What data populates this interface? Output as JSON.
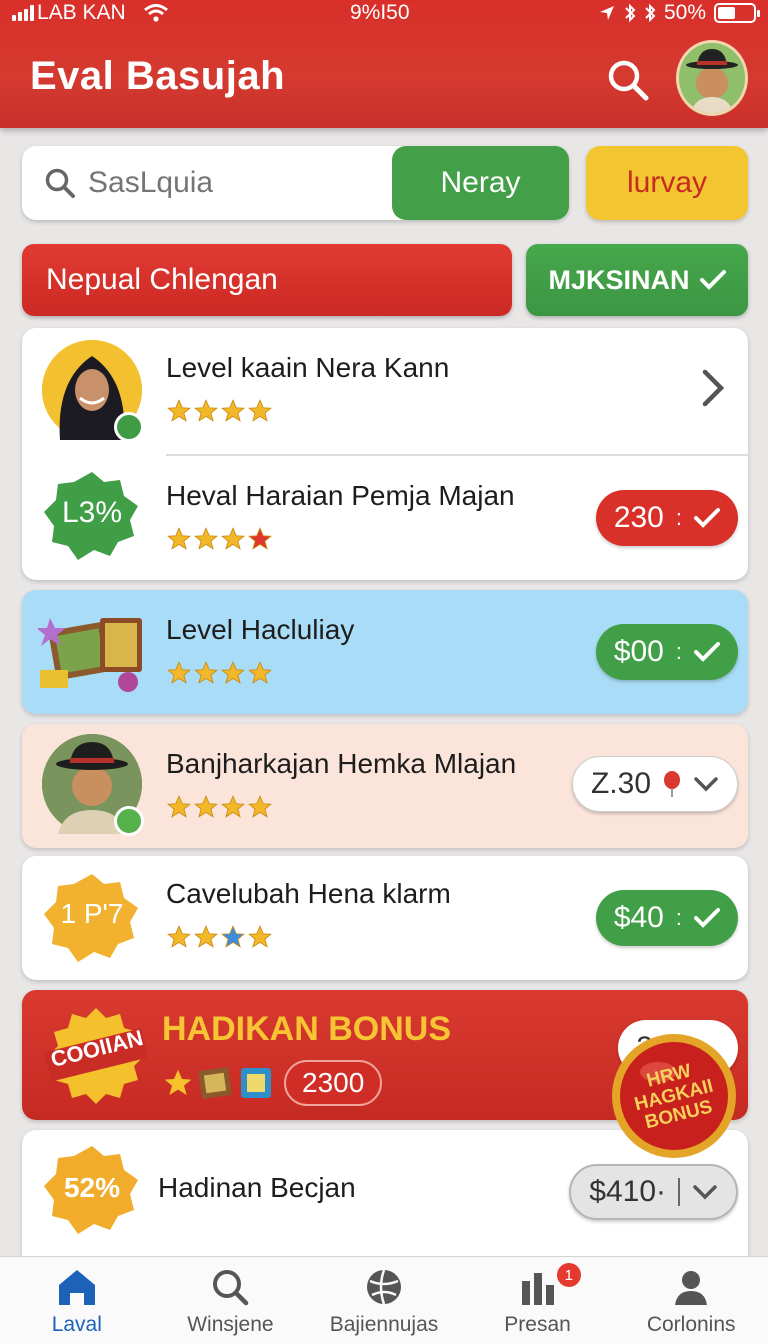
{
  "status": {
    "carrier": "LAB KAN",
    "time": "9%I50",
    "battery": "50%"
  },
  "header": {
    "title": "Eval Basujah"
  },
  "search": {
    "placeholder": "SasLquia",
    "button": "Neray"
  },
  "yellow_button": "lurvay",
  "banner": {
    "red_label": "Nepual Chlengan",
    "green_label": "MJKSINAN"
  },
  "items": [
    {
      "title": "Level kaain Nera Kann",
      "stars": [
        "gold",
        "gold",
        "gold",
        "gold"
      ]
    },
    {
      "title": "Heval Haraian Pemja Majan",
      "badge": "L3%",
      "stars": [
        "gold",
        "gold",
        "gold",
        "red"
      ],
      "price": "230",
      "colon": ":"
    },
    {
      "title": "Level Hacluliay",
      "stars": [
        "gold",
        "gold",
        "gold",
        "gold"
      ],
      "price": "$00",
      "colon": ":"
    },
    {
      "title": "Banjharkajan Hemka Mlajan",
      "stars": [
        "gold",
        "gold",
        "gold",
        "gold"
      ],
      "price": "Z.30"
    },
    {
      "title": "Cavelubah Hena klarm",
      "badge": "1 P'7",
      "stars": [
        "gold",
        "gold",
        "blue",
        "gold"
      ],
      "price": "$40",
      "colon": ":"
    },
    {
      "title": "HADIKAN BONUS",
      "badge": "COOIIAN",
      "count": "2300",
      "price": "2.3",
      "seal": "HRW HAGKAII BONUS"
    },
    {
      "title": "Hadinan Becjan",
      "badge": "52%",
      "price": "$410·"
    }
  ],
  "nav": [
    {
      "label": "Laval",
      "icon": "home-icon",
      "active": true
    },
    {
      "label": "Winsjene",
      "icon": "search-icon"
    },
    {
      "label": "Bajiennujas",
      "icon": "ball-icon"
    },
    {
      "label": "Presan",
      "icon": "chart-icon",
      "badge": "1"
    },
    {
      "label": "Corlonins",
      "icon": "profile-icon"
    }
  ],
  "colors": {
    "primary_red": "#d6322c",
    "green": "#43a048",
    "yellow": "#f3c530",
    "blue": "#1c62b9"
  }
}
